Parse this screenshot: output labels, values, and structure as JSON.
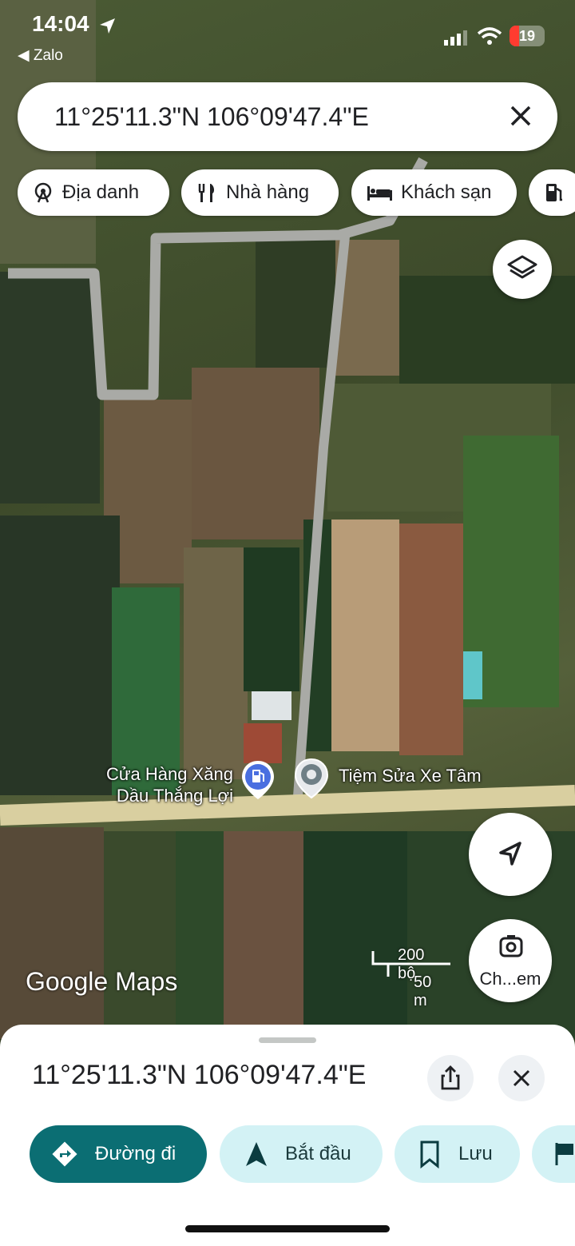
{
  "status": {
    "time": "14:04",
    "back_app": "Zalo",
    "battery": "19"
  },
  "search": {
    "query": "11°25'11.3\"N 106°09'47.4\"E"
  },
  "chips": [
    {
      "label": "Địa danh",
      "icon": "ferris-wheel-icon"
    },
    {
      "label": "Nhà hàng",
      "icon": "fork-knife-icon"
    },
    {
      "label": "Khách sạn",
      "icon": "bed-icon"
    },
    {
      "label": "",
      "icon": "gas-station-icon"
    }
  ],
  "map": {
    "place_labels": [
      {
        "text_line1": "Cửa Hàng Xăng",
        "text_line2": "Dầu Thắng Lợi",
        "icon": "gas-pin-icon"
      },
      {
        "text_line1": "Tiệm Sửa Xe Tâm",
        "icon": "location-pin-icon"
      }
    ],
    "scale": {
      "imperial": "200 bộ",
      "metric": "50 m"
    },
    "watermark": "Google Maps",
    "camera_button_label": "Ch...em"
  },
  "sheet": {
    "title": "11°25'11.3\"N 106°09'47.4\"E",
    "actions": [
      {
        "label": "Đường đi",
        "icon": "directions-icon"
      },
      {
        "label": "Bắt đầu",
        "icon": "navigation-arrow-icon"
      },
      {
        "label": "Lưu",
        "icon": "bookmark-icon"
      },
      {
        "label": "",
        "icon": "flag-icon"
      }
    ]
  },
  "colors": {
    "accent": "#0b57d0",
    "primary_button": "#0b6e73",
    "secondary_button": "#d3f2f5"
  }
}
